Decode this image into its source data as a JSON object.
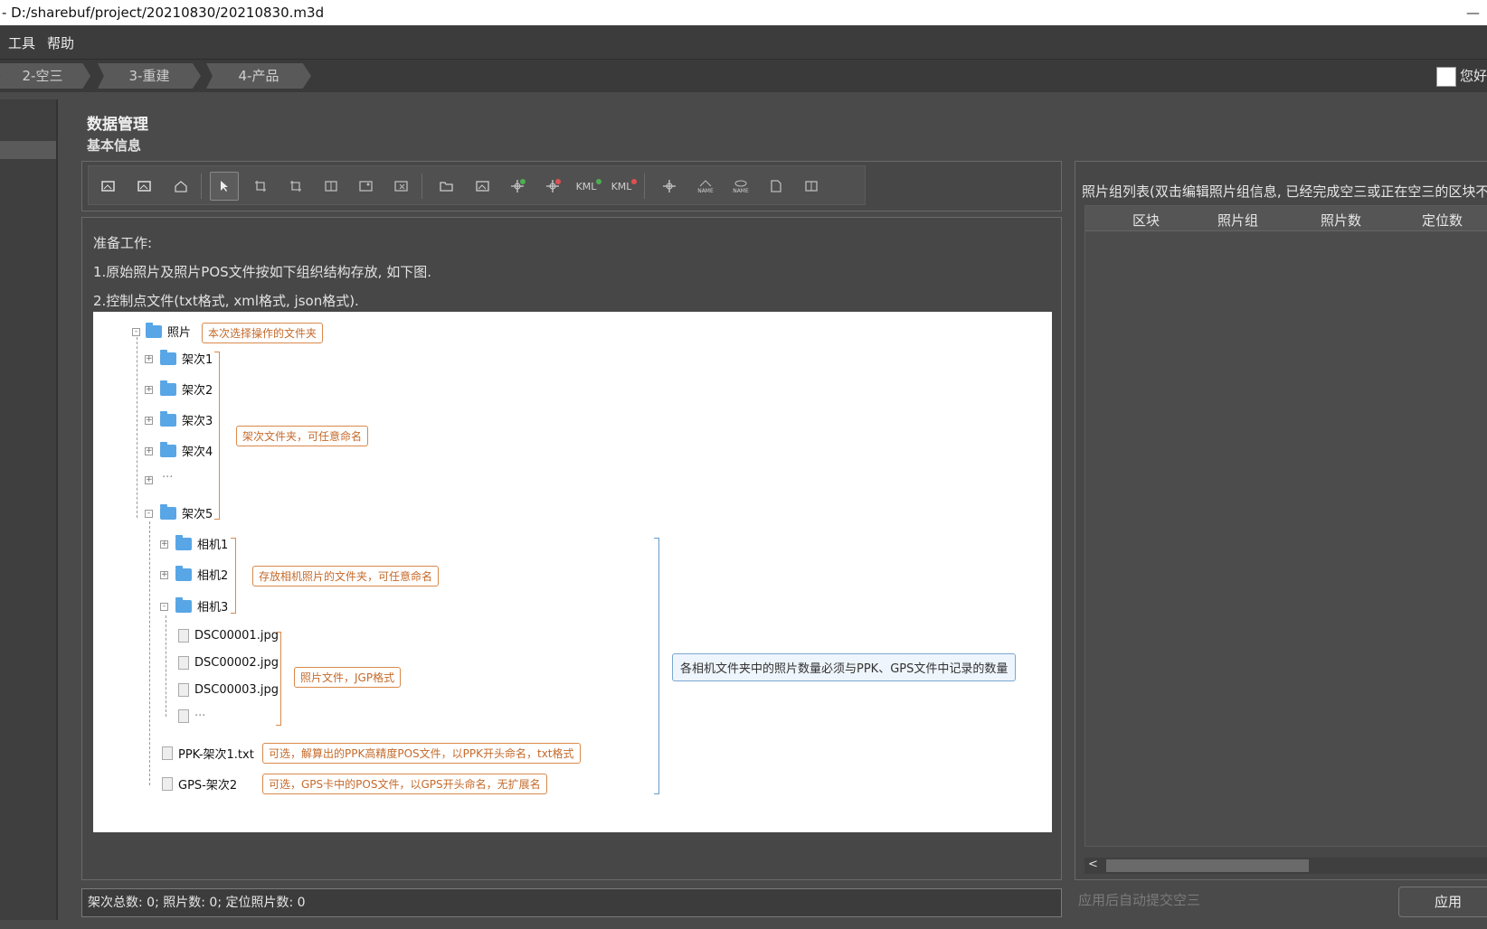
{
  "title_bar": {
    "title": "- D:/sharebuf/project/20210830/20210830.m3d",
    "minimize": "—"
  },
  "menu": {
    "items": [
      "工具",
      "帮助"
    ]
  },
  "steps": [
    "2-空三",
    "3-重建",
    "4-产品"
  ],
  "user": {
    "greeting": "您好"
  },
  "main": {
    "heading": "数据管理",
    "subheading": "基本信息",
    "toolbar": {
      "icons": [
        "import-image-icon",
        "add-image-icon",
        "home-icon",
        "select-icon",
        "crop-icon",
        "crop-alt-icon",
        "flip-icon",
        "image-icon",
        "image-delete-icon",
        "open-folder-icon",
        "picture-icon",
        "add-control-point-icon",
        "remove-control-point-icon",
        "kml-add-icon",
        "kml-remove-icon",
        "target-icon",
        "name-satellite-icon",
        "name-eye-icon",
        "document-icon",
        "flip-alt-icon"
      ],
      "kml_text": "KML",
      "name_text": "NAME"
    },
    "prep_lines": [
      "准备工作:",
      "1.原始照片及照片POS文件按如下组织结构存放, 如下图.",
      "2.控制点文件(txt格式, xml格式, json格式)."
    ],
    "diagram": {
      "root": "照片",
      "root_label": "本次选择操作的文件夹",
      "flights": [
        "架次1",
        "架次2",
        "架次3",
        "架次4",
        "···",
        "架次5"
      ],
      "flights_label": "架次文件夹，可任意命名",
      "cameras": [
        "相机1",
        "相机2",
        "相机3"
      ],
      "cameras_label": "存放相机照片的文件夹，可任意命名",
      "photos": [
        "DSC00001.jpg",
        "DSC00002.jpg",
        "DSC00003.jpg",
        "···"
      ],
      "photos_label": "照片文件，JGP格式",
      "ppk_file": "PPK-架次1.txt",
      "ppk_label": "可选，解算出的PPK高精度POS文件，以PPK开头命名，txt格式",
      "gps_file": "GPS-架次2",
      "gps_label": "可选，GPS卡中的POS文件，以GPS开头命名，无扩展名",
      "note_label": "各相机文件夹中的照片数量必须与PPK、GPS文件中记录的数量"
    },
    "status": "架次总数: 0; 照片数: 0; 定位照片数: 0"
  },
  "right": {
    "title": "照片组列表(双击编辑照片组信息, 已经完成空三或正在空三的区块不",
    "columns": [
      "区块",
      "照片组",
      "照片数",
      "定位数"
    ],
    "auto_submit": "应用后自动提交空三",
    "apply": "应用"
  },
  "colors": {
    "accent_orange": "#c56a2a",
    "accent_blue": "#6a9cc9",
    "folder_blue": "#58a6e6"
  }
}
